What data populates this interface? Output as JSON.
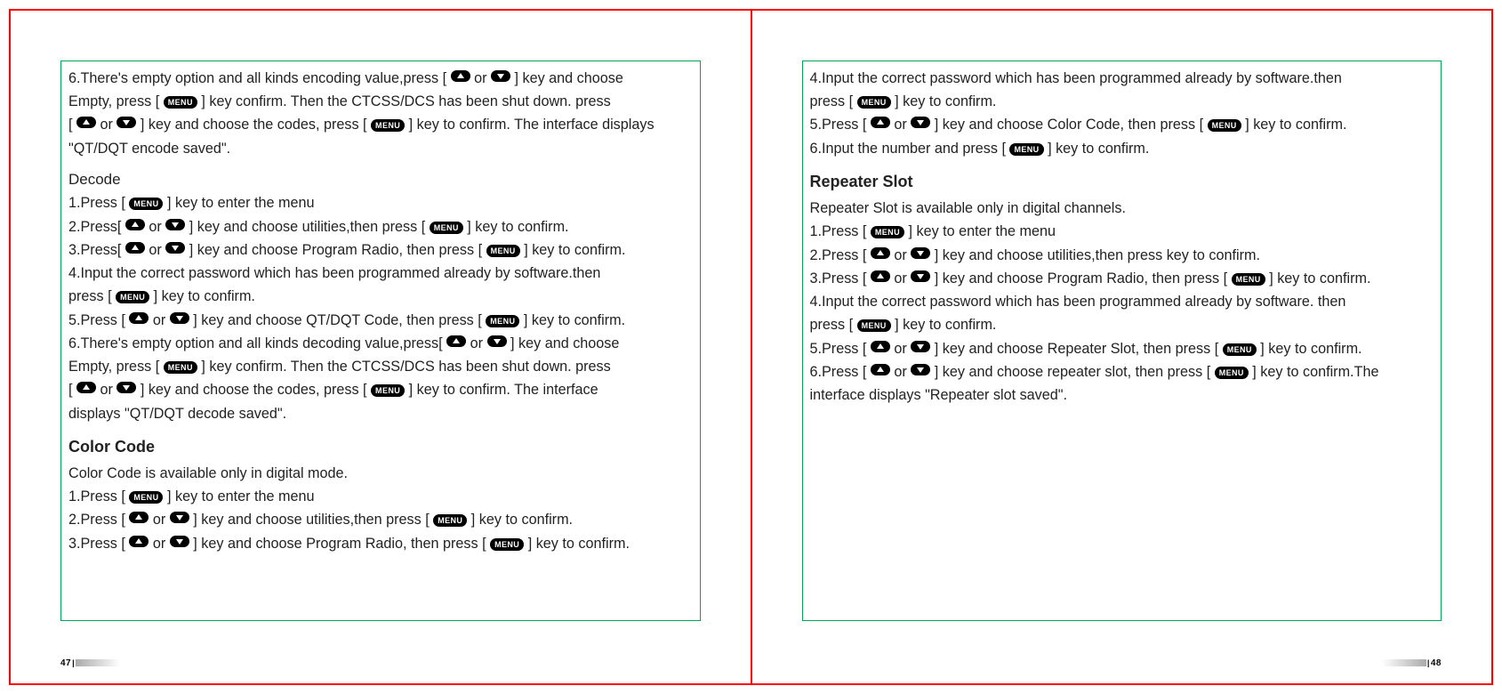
{
  "left_page": {
    "number": "47",
    "lines": [
      {
        "t": "step",
        "parts": [
          "6.There's empty option and all kinds encoding value,press [ ",
          "UP",
          " or ",
          "DOWN",
          " ] key and choose"
        ]
      },
      {
        "t": "cont",
        "parts": [
          "Empty, press [ ",
          "MENU",
          " ] key confirm. Then the CTCSS/DCS has been shut down. press"
        ]
      },
      {
        "t": "cont",
        "parts": [
          "[ ",
          "UP",
          " or ",
          "DOWN",
          " ] key and choose the codes, press [ ",
          "MENU",
          " ] key to confirm. The interface displays"
        ]
      },
      {
        "t": "cont",
        "parts": [
          "\"QT/DQT encode saved\"."
        ]
      },
      {
        "t": "subheading",
        "text": "Decode"
      },
      {
        "t": "step",
        "parts": [
          "1.Press [ ",
          "MENU",
          " ] key to enter the menu"
        ]
      },
      {
        "t": "step",
        "parts": [
          "2.Press[ ",
          "UP",
          " or ",
          "DOWN",
          " ] key and choose utilities,then press [ ",
          "MENU",
          " ] key to confirm."
        ]
      },
      {
        "t": "step",
        "parts": [
          "3.Press[ ",
          "UP",
          " or ",
          "DOWN",
          " ] key and choose Program Radio, then press [ ",
          "MENU",
          " ] key to confirm."
        ]
      },
      {
        "t": "step",
        "parts": [
          "4.Input the correct password which has been programmed already by software.then"
        ]
      },
      {
        "t": "cont",
        "parts": [
          "press [ ",
          "MENU",
          " ] key to confirm."
        ]
      },
      {
        "t": "step",
        "parts": [
          "5.Press [ ",
          "UP",
          " or ",
          "DOWN",
          " ] key and choose QT/DQT Code, then press [ ",
          "MENU",
          " ] key to confirm."
        ]
      },
      {
        "t": "step",
        "parts": [
          "6.There's empty option and all kinds decoding value,press[ ",
          "UP",
          " or ",
          "DOWN",
          " ] key and choose"
        ]
      },
      {
        "t": "cont",
        "parts": [
          "Empty, press [ ",
          "MENU",
          " ] key confirm. Then the CTCSS/DCS has been shut down. press"
        ]
      },
      {
        "t": "cont",
        "parts": [
          " [ ",
          "UP",
          " or ",
          "DOWN",
          " ] key and choose the codes, press [ ",
          "MENU",
          " ] key to confirm. The interface"
        ]
      },
      {
        "t": "cont",
        "parts": [
          "displays \"QT/DQT decode saved\"."
        ]
      },
      {
        "t": "heading",
        "text": "Color Code"
      },
      {
        "t": "step",
        "parts": [
          "Color Code is available only in digital mode."
        ]
      },
      {
        "t": "step",
        "parts": [
          "1.Press [ ",
          "MENU",
          " ] key to enter the menu"
        ]
      },
      {
        "t": "step",
        "parts": [
          "2.Press [ ",
          "UP",
          " or ",
          "DOWN",
          " ] key and choose utilities,then press [ ",
          "MENU",
          " ] key to confirm."
        ]
      },
      {
        "t": "step",
        "parts": [
          "3.Press [ ",
          "UP",
          " or ",
          "DOWN",
          " ] key and choose Program Radio, then press [ ",
          "MENU",
          " ] key to confirm."
        ]
      }
    ]
  },
  "right_page": {
    "number": "48",
    "lines": [
      {
        "t": "step",
        "parts": [
          "4.Input the correct password which has been programmed already by software.then"
        ]
      },
      {
        "t": "cont",
        "parts": [
          "press [ ",
          "MENU",
          " ] key to confirm."
        ]
      },
      {
        "t": "step",
        "parts": [
          "5.Press [ ",
          "UP",
          " or ",
          "DOWN",
          " ] key and choose Color Code, then press [ ",
          "MENU",
          " ] key to confirm."
        ]
      },
      {
        "t": "step",
        "parts": [
          "6.Input the number and press [ ",
          "MENU",
          " ] key to confirm."
        ]
      },
      {
        "t": "heading",
        "text": "Repeater Slot"
      },
      {
        "t": "step",
        "parts": [
          "Repeater Slot is available only in digital channels."
        ]
      },
      {
        "t": "step",
        "parts": [
          "1.Press [ ",
          "MENU",
          " ] key to enter the menu"
        ]
      },
      {
        "t": "step",
        "parts": [
          "2.Press [ ",
          "UP",
          " or ",
          "DOWN",
          " ] key and choose utilities,then press  key to confirm."
        ]
      },
      {
        "t": "step",
        "parts": [
          "3.Press [ ",
          "UP",
          " or ",
          "DOWN",
          " ] key and choose Program Radio, then press [ ",
          "MENU",
          " ] key to confirm."
        ]
      },
      {
        "t": "step",
        "parts": [
          "4.Input the correct password which has been programmed already by software. then"
        ]
      },
      {
        "t": "cont",
        "parts": [
          "press [ ",
          "MENU",
          " ] key to confirm."
        ]
      },
      {
        "t": "step",
        "parts": [
          "5.Press [ ",
          "UP",
          " or ",
          "DOWN",
          " ] key and choose Repeater Slot, then press [ ",
          "MENU",
          " ] key to confirm."
        ]
      },
      {
        "t": "step",
        "parts": [
          "6.Press [ ",
          "UP",
          " or ",
          "DOWN",
          " ] key and choose repeater slot, then press [ ",
          "MENU",
          " ] key to confirm.The"
        ]
      },
      {
        "t": "cont",
        "parts": [
          "interface displays \"Repeater slot saved\"."
        ]
      }
    ]
  }
}
